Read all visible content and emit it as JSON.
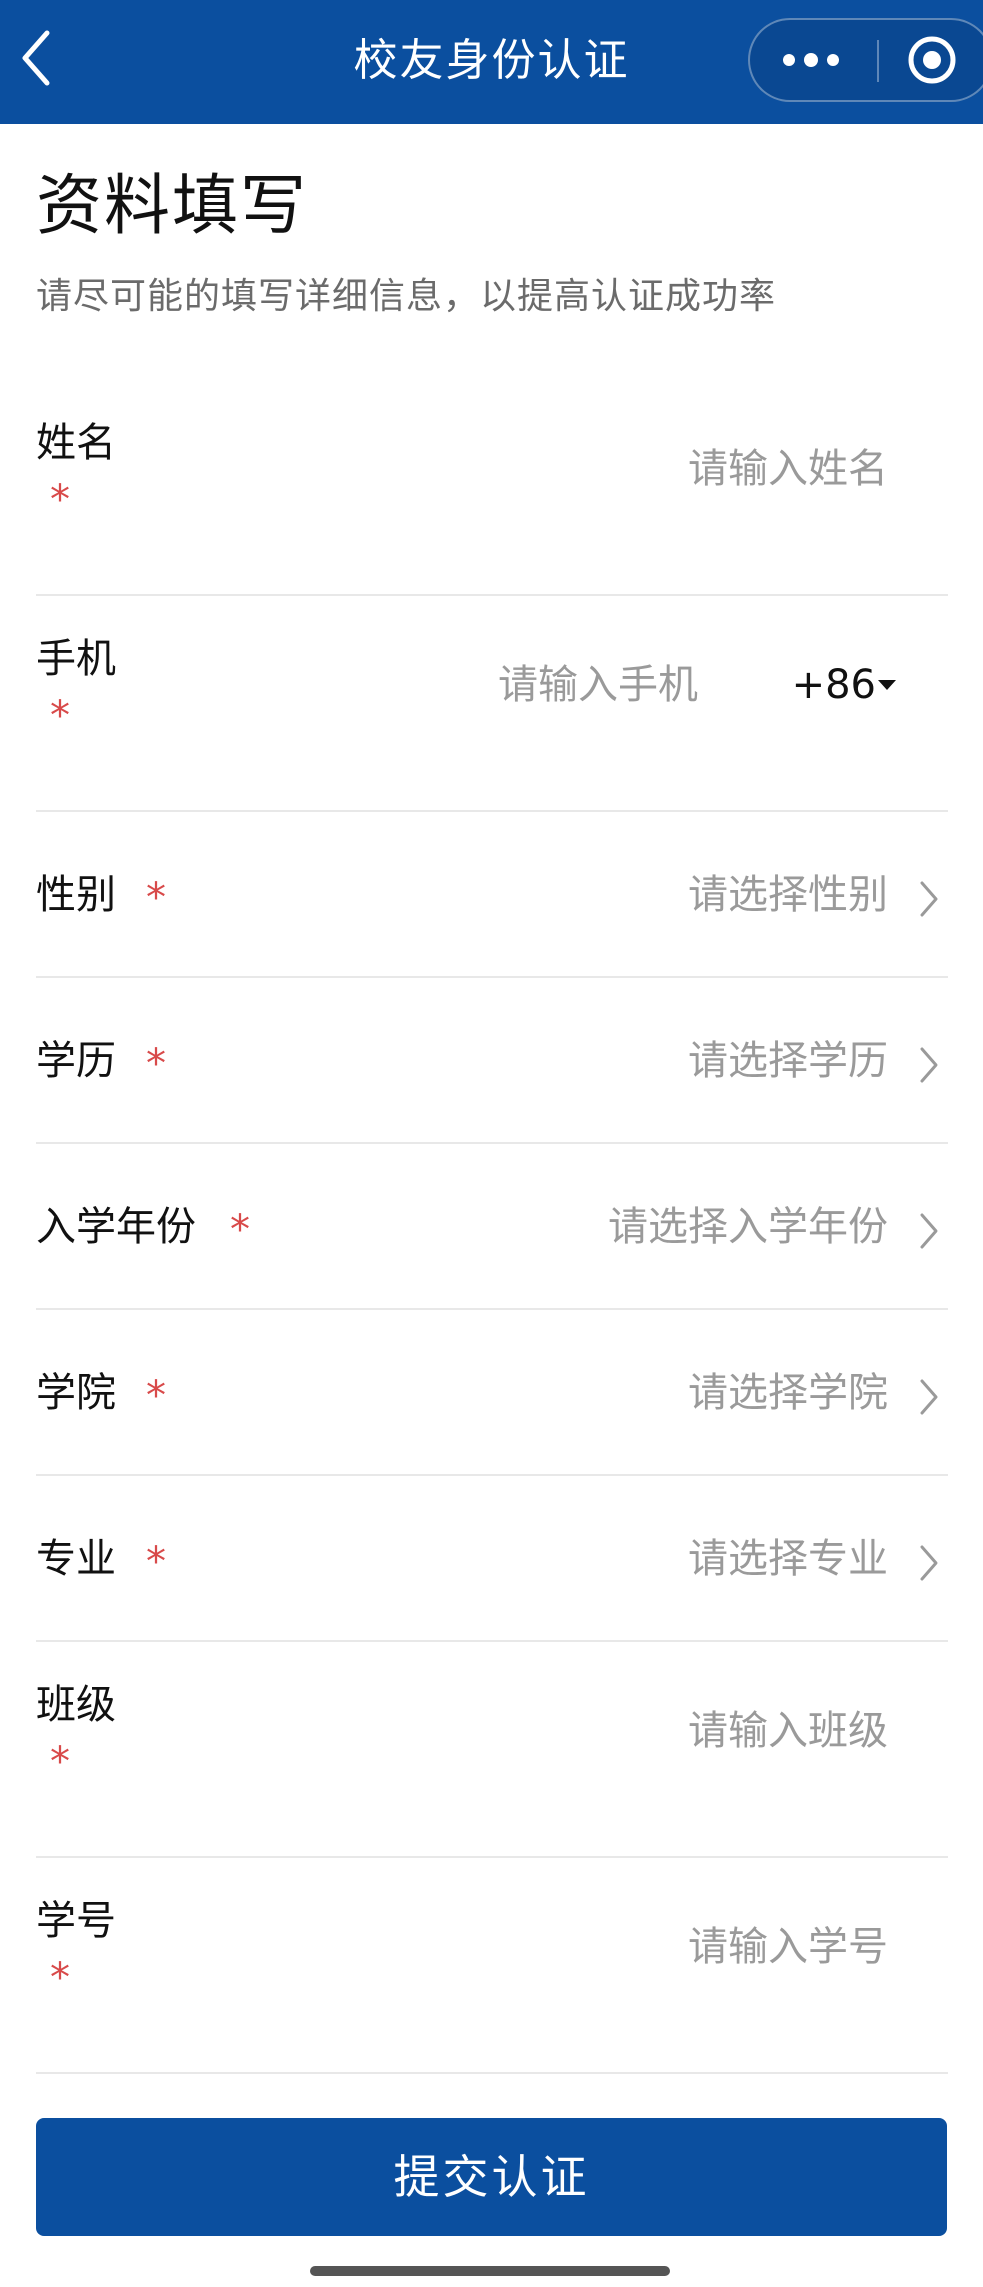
{
  "header": {
    "title": "校友身份认证",
    "back_icon": "chevron-left-icon",
    "more_icon": "more-dots-icon",
    "close_icon": "target-circle-icon",
    "color": "#0b4f9f"
  },
  "intro": {
    "title": "资料填写",
    "subtitle": "请尽可能的填写详细信息，以提高认证成功率"
  },
  "required_mark": "*",
  "fields": [
    {
      "label": "姓名",
      "placeholder": "请输入姓名",
      "kind": "input"
    },
    {
      "label": "手机",
      "placeholder": "请输入手机",
      "kind": "phone",
      "country_code": "+86"
    },
    {
      "label": "性别",
      "placeholder": "请选择性别",
      "kind": "select"
    },
    {
      "label": "学历",
      "placeholder": "请选择学历",
      "kind": "select"
    },
    {
      "label": "入学年份",
      "placeholder": "请选择入学年份",
      "kind": "select"
    },
    {
      "label": "学院",
      "placeholder": "请选择学院",
      "kind": "select"
    },
    {
      "label": "专业",
      "placeholder": "请选择专业",
      "kind": "select"
    },
    {
      "label": "班级",
      "placeholder": "请输入班级",
      "kind": "input"
    },
    {
      "label": "学号",
      "placeholder": "请输入学号",
      "kind": "input"
    }
  ],
  "submit": {
    "label": "提交认证"
  },
  "colors": {
    "accent": "#0b4f9f",
    "required": "#d84a4a",
    "placeholder": "#9a9a9a"
  }
}
